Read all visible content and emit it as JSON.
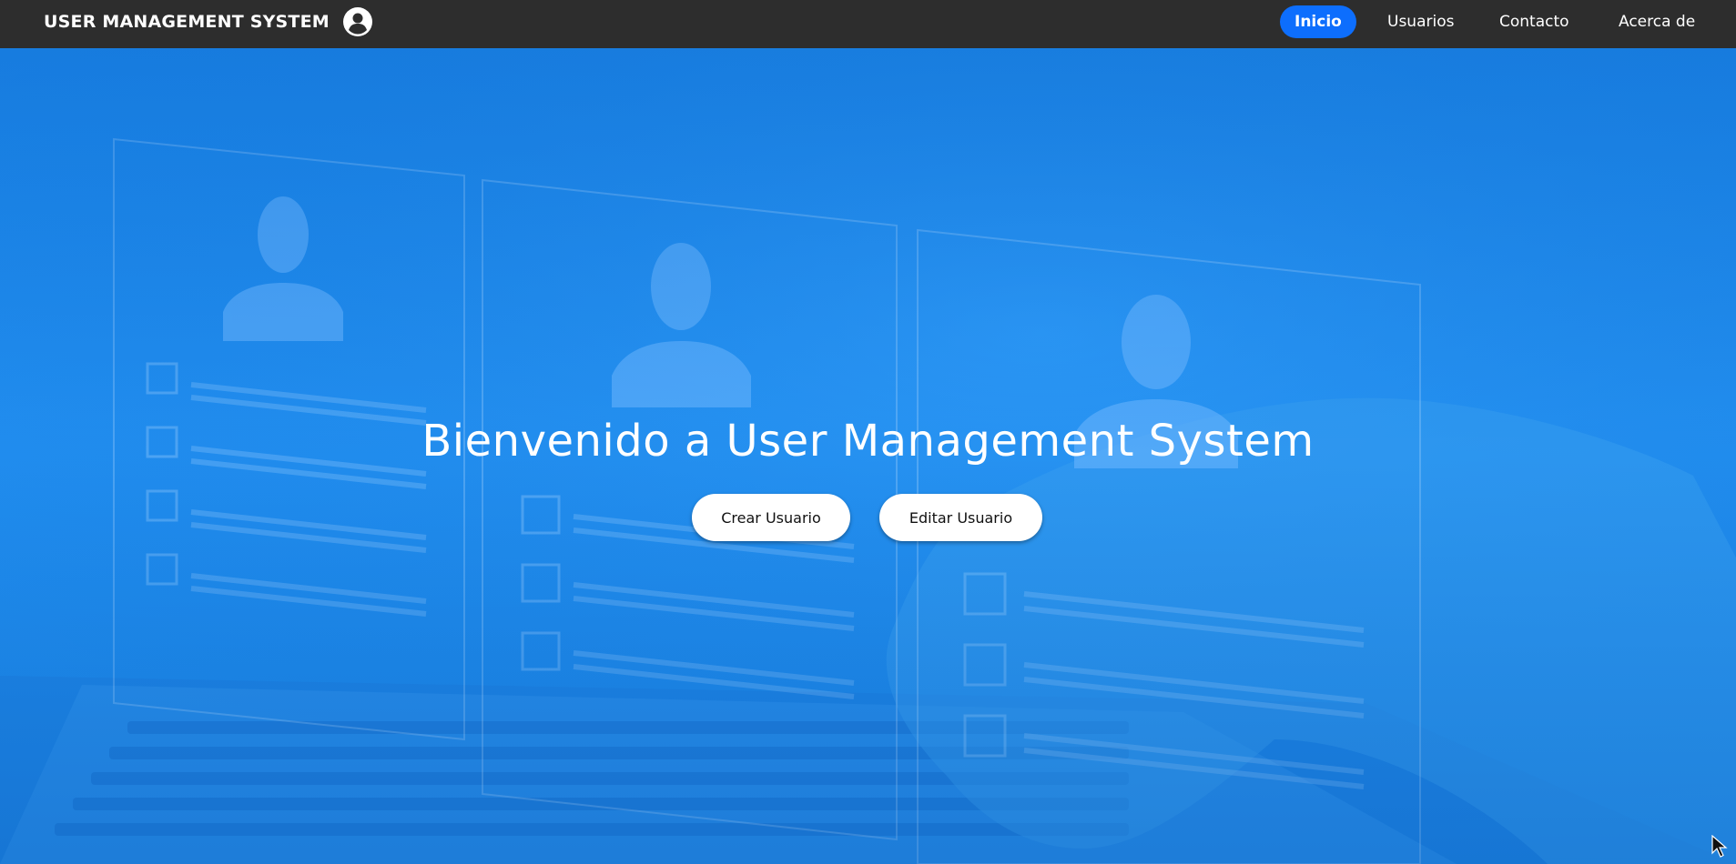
{
  "brand": {
    "title": "USER MANAGEMENT SYSTEM",
    "icon": "user-circle-icon"
  },
  "nav": {
    "links": [
      {
        "label": "Inicio",
        "active": true
      },
      {
        "label": "Usuarios",
        "active": false
      },
      {
        "label": "Contacto",
        "active": false
      },
      {
        "label": "Acerca de",
        "active": false
      }
    ]
  },
  "hero": {
    "title": "Bienvenido a User Management System",
    "create_label": "Crear Usuario",
    "edit_label": "Editar Usuario"
  },
  "colors": {
    "navbar_bg": "#2d2d2d",
    "accent": "#0d6efd",
    "hero_blue": "#1e8bee"
  }
}
